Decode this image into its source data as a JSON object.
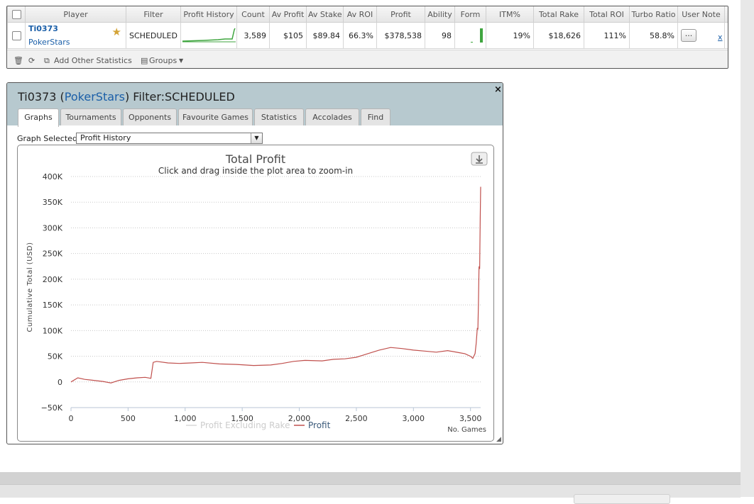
{
  "stats_table": {
    "columns": [
      "",
      "Player",
      "Filter",
      "Profit History",
      "Count",
      "Av Profit",
      "Av Stake",
      "Av ROI",
      "Profit",
      "Ability",
      "Form",
      "ITM%",
      "Total Rake",
      "Total ROI",
      "Turbo Ratio",
      "User Note",
      ""
    ],
    "row": {
      "player_name": "Ti0373",
      "site": "PokerStars",
      "filter": "SCHEDULED",
      "count": "3,589",
      "av_profit": "$105",
      "av_stake": "$89.84",
      "av_roi": "66.3%",
      "profit": "$378,538",
      "ability": "98",
      "itm": "19%",
      "total_rake": "$18,626",
      "total_roi": "111%",
      "turbo_ratio": "58.8%",
      "note_button": "...",
      "close_link": "x"
    },
    "toolbar": {
      "add_stats": "Add Other Statistics",
      "groups": "Groups"
    }
  },
  "popup": {
    "player": "Ti0373",
    "site": "PokerStars",
    "filter_prefix": "Filter:",
    "filter": "SCHEDULED",
    "close": "×",
    "tabs": [
      "Graphs",
      "Tournaments",
      "Opponents",
      "Favourite Games",
      "Statistics",
      "Accolades",
      "Find"
    ],
    "active_tab": "Graphs",
    "graph_selected_label": "Graph Selected:",
    "graph_selected_value": "Profit History"
  },
  "colors": {
    "profit_line": "#c0504d",
    "excl_rake_line": "#d9d9d9",
    "header_band": "#b7c9cf",
    "link": "#1b5fa8"
  },
  "chart_data": {
    "type": "line",
    "title": "Total Profit",
    "subtitle": "Click and drag inside the plot area to zoom-in",
    "xlabel": "No. Games",
    "ylabel": "Cumulative Total (USD)",
    "xlim": [
      0,
      3589
    ],
    "ylim": [
      -50000,
      400000
    ],
    "yticks": [
      400000,
      350000,
      300000,
      250000,
      200000,
      150000,
      100000,
      50000,
      0,
      -50000
    ],
    "ytick_labels": [
      "400K",
      "350K",
      "300K",
      "250K",
      "200K",
      "150K",
      "100K",
      "50K",
      "0",
      "−50K"
    ],
    "xticks": [
      0,
      500,
      1000,
      1500,
      2000,
      2500,
      3000,
      3500
    ],
    "xtick_labels": [
      "0",
      "500",
      "1,000",
      "1,500",
      "2,000",
      "2,500",
      "3,000",
      "3,500"
    ],
    "grid": "horizontal dotted",
    "legend": "bottom",
    "series": [
      {
        "name": "Profit Excluding Rake",
        "x": [],
        "y": []
      },
      {
        "name": "Profit",
        "x": [
          0,
          60,
          120,
          200,
          280,
          350,
          420,
          500,
          580,
          650,
          700,
          720,
          750,
          850,
          950,
          1050,
          1150,
          1300,
          1450,
          1600,
          1750,
          1850,
          1950,
          2050,
          2200,
          2300,
          2400,
          2500,
          2600,
          2700,
          2800,
          2900,
          3000,
          3100,
          3200,
          3300,
          3400,
          3450,
          3500,
          3520,
          3540,
          3550,
          3560,
          3565,
          3570,
          3575,
          3580,
          3585,
          3589
        ],
        "y": [
          0,
          8000,
          5000,
          3000,
          1000,
          -2000,
          3000,
          6000,
          8000,
          9000,
          7000,
          38000,
          40000,
          37000,
          36000,
          37000,
          38000,
          35000,
          34000,
          32000,
          33000,
          36000,
          40000,
          42000,
          41000,
          44000,
          45000,
          48000,
          55000,
          62000,
          67000,
          65000,
          62000,
          60000,
          58000,
          61000,
          57000,
          55000,
          50000,
          46000,
          55000,
          75000,
          105000,
          102000,
          155000,
          225000,
          220000,
          320000,
          380000
        ]
      }
    ]
  }
}
